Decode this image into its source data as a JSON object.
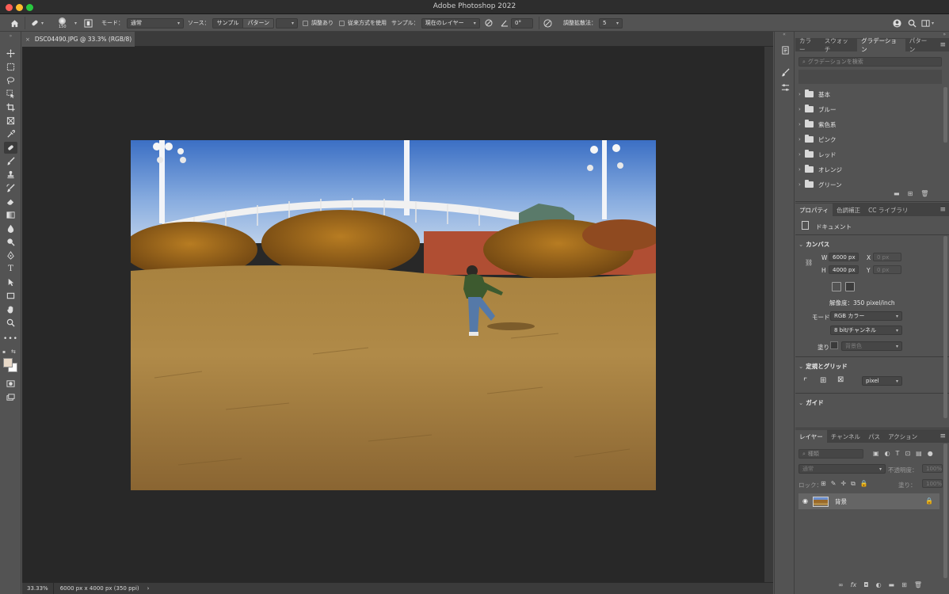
{
  "window": {
    "title": "Adobe Photoshop 2022"
  },
  "options": {
    "brush_size": "150",
    "mode_label": "モード：",
    "mode_value": "通常",
    "source_label": "ソース：",
    "source_sample": "サンプル",
    "source_pattern": "パターン",
    "aligned": "調整あり",
    "legacy": "従来方式を使用",
    "sample_label": "サンプル：",
    "sample_value": "現在のレイヤー",
    "angle": "0°",
    "diffusion_label": "調整拡散法：",
    "diffusion_value": "5"
  },
  "document": {
    "tab_title": "DSC04490.JPG @ 33.3% (RGB/8)",
    "zoom": "33.33%",
    "info": "6000 px x 4000 px (350 ppi)"
  },
  "gradients_panel": {
    "tabs": [
      "カラー",
      "スウォッチ",
      "グラデーション",
      "パターン"
    ],
    "active_tab": 2,
    "search_placeholder": "グラデーションを検索",
    "folders": [
      "基本",
      "ブルー",
      "紫色系",
      "ピンク",
      "レッド",
      "オレンジ",
      "グリーン"
    ]
  },
  "properties_panel": {
    "tabs": [
      "プロパティ",
      "色調補正",
      "CC ライブラリ"
    ],
    "active_tab": 0,
    "doc_label": "ドキュメント",
    "canvas_header": "カンバス",
    "w_label": "W",
    "w_value": "6000 px",
    "h_label": "H",
    "h_value": "4000 px",
    "x_label": "X",
    "x_value": "0 px",
    "y_label": "Y",
    "y_value": "0 px",
    "resolution": "解像度：350 pixel/inch",
    "mode_label": "モード",
    "mode_value": "RGB カラー",
    "depth_value": "8 bit/チャンネル",
    "fill_label": "塗り",
    "fill_value": "背景色",
    "rulers_header": "定規とグリッド",
    "unit_value": "pixel",
    "guides_header": "ガイド"
  },
  "layers_panel": {
    "tabs": [
      "レイヤー",
      "チャンネル",
      "パス",
      "アクション"
    ],
    "active_tab": 0,
    "filter_placeholder": "種類",
    "blend_value": "通常",
    "opacity_label": "不透明度：",
    "opacity_value": "100%",
    "lock_label": "ロック：",
    "fill_label": "塗り：",
    "fill_value": "100%",
    "layers": [
      {
        "name": "背景",
        "visible": true,
        "locked": true
      }
    ]
  },
  "colors": {
    "foreground": "#e8d9c8",
    "background": "#ffffff"
  }
}
